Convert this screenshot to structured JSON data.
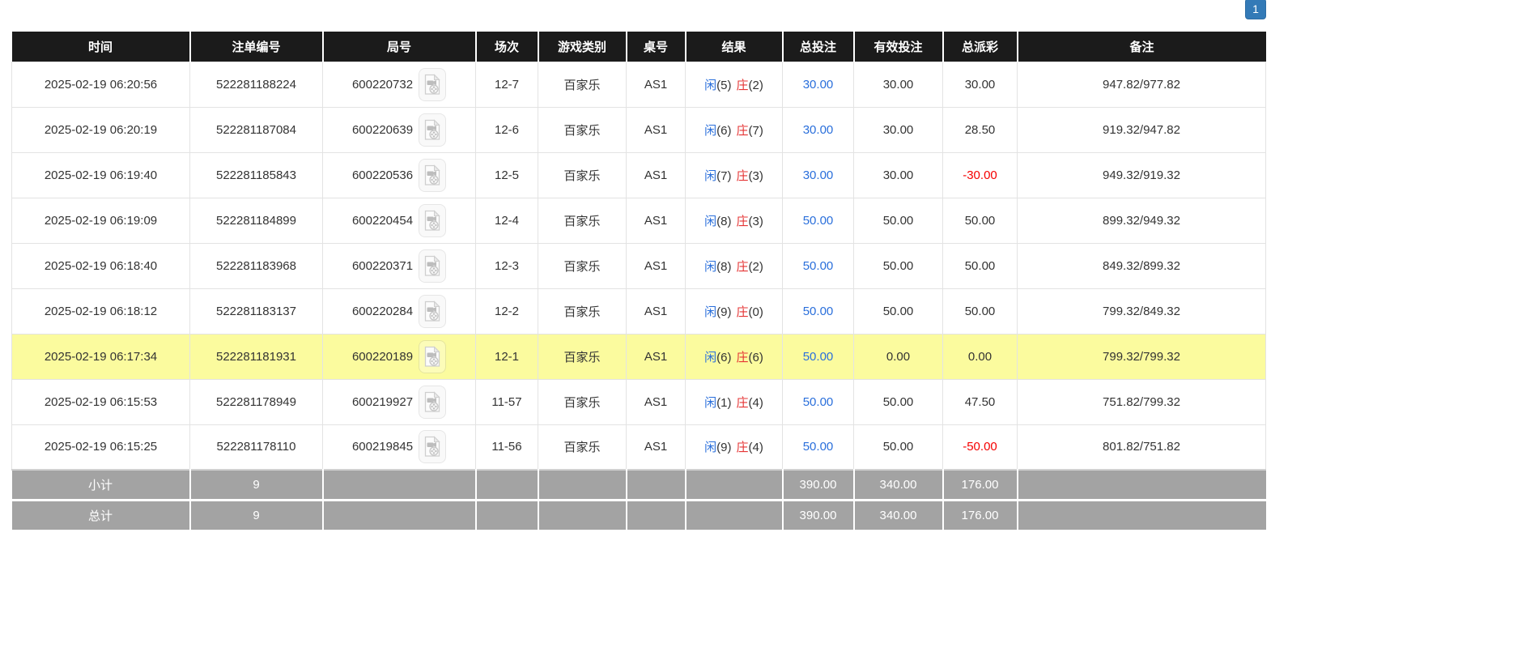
{
  "pagination": {
    "current_page": "1"
  },
  "colors": {
    "header_bg": "#1b1b1b",
    "footer_bg": "#a3a3a3",
    "highlight_yellow": "#fbfb9e",
    "player_blue": "#2a6fdb",
    "banker_red": "#e53535",
    "amount_blue": "#2a6fdb",
    "negative_red": "#f50000",
    "pagination_blue": "#337ab7"
  },
  "table": {
    "headers": [
      "时间",
      "注单编号",
      "局号",
      "场次",
      "游戏类别",
      "桌号",
      "结果",
      "总投注",
      "有效投注",
      "总派彩",
      "备注"
    ],
    "rows": [
      {
        "time": "2025-02-19 06:20:56",
        "bet_id": "522281188224",
        "round_id": "600220732",
        "session": "12-7",
        "game_type": "百家乐",
        "table_no": "AS1",
        "result": {
          "player": "闲",
          "player_pts": "(5)",
          "banker": "庄",
          "banker_pts": "(2)"
        },
        "total_bet": "30.00",
        "valid_bet": "30.00",
        "payout": "30.00",
        "remark": "947.82/977.82",
        "highlighted": false
      },
      {
        "time": "2025-02-19 06:20:19",
        "bet_id": "522281187084",
        "round_id": "600220639",
        "session": "12-6",
        "game_type": "百家乐",
        "table_no": "AS1",
        "result": {
          "player": "闲",
          "player_pts": "(6)",
          "banker": "庄",
          "banker_pts": "(7)"
        },
        "total_bet": "30.00",
        "valid_bet": "30.00",
        "payout": "28.50",
        "remark": "919.32/947.82",
        "highlighted": false
      },
      {
        "time": "2025-02-19 06:19:40",
        "bet_id": "522281185843",
        "round_id": "600220536",
        "session": "12-5",
        "game_type": "百家乐",
        "table_no": "AS1",
        "result": {
          "player": "闲",
          "player_pts": "(7)",
          "banker": "庄",
          "banker_pts": "(3)"
        },
        "total_bet": "30.00",
        "valid_bet": "30.00",
        "payout": "-30.00",
        "remark": "949.32/919.32",
        "highlighted": false
      },
      {
        "time": "2025-02-19 06:19:09",
        "bet_id": "522281184899",
        "round_id": "600220454",
        "session": "12-4",
        "game_type": "百家乐",
        "table_no": "AS1",
        "result": {
          "player": "闲",
          "player_pts": "(8)",
          "banker": "庄",
          "banker_pts": "(3)"
        },
        "total_bet": "50.00",
        "valid_bet": "50.00",
        "payout": "50.00",
        "remark": "899.32/949.32",
        "highlighted": false
      },
      {
        "time": "2025-02-19 06:18:40",
        "bet_id": "522281183968",
        "round_id": "600220371",
        "session": "12-3",
        "game_type": "百家乐",
        "table_no": "AS1",
        "result": {
          "player": "闲",
          "player_pts": "(8)",
          "banker": "庄",
          "banker_pts": "(2)"
        },
        "total_bet": "50.00",
        "valid_bet": "50.00",
        "payout": "50.00",
        "remark": "849.32/899.32",
        "highlighted": false
      },
      {
        "time": "2025-02-19 06:18:12",
        "bet_id": "522281183137",
        "round_id": "600220284",
        "session": "12-2",
        "game_type": "百家乐",
        "table_no": "AS1",
        "result": {
          "player": "闲",
          "player_pts": "(9)",
          "banker": "庄",
          "banker_pts": "(0)"
        },
        "total_bet": "50.00",
        "valid_bet": "50.00",
        "payout": "50.00",
        "remark": "799.32/849.32",
        "highlighted": false
      },
      {
        "time": "2025-02-19 06:17:34",
        "bet_id": "522281181931",
        "round_id": "600220189",
        "session": "12-1",
        "game_type": "百家乐",
        "table_no": "AS1",
        "result": {
          "player": "闲",
          "player_pts": "(6)",
          "banker": "庄",
          "banker_pts": "(6)"
        },
        "total_bet": "50.00",
        "valid_bet": "0.00",
        "payout": "0.00",
        "remark": "799.32/799.32",
        "highlighted": true
      },
      {
        "time": "2025-02-19 06:15:53",
        "bet_id": "522281178949",
        "round_id": "600219927",
        "session": "11-57",
        "game_type": "百家乐",
        "table_no": "AS1",
        "result": {
          "player": "闲",
          "player_pts": "(1)",
          "banker": "庄",
          "banker_pts": "(4)"
        },
        "total_bet": "50.00",
        "valid_bet": "50.00",
        "payout": "47.50",
        "remark": "751.82/799.32",
        "highlighted": false
      },
      {
        "time": "2025-02-19 06:15:25",
        "bet_id": "522281178110",
        "round_id": "600219845",
        "session": "11-56",
        "game_type": "百家乐",
        "table_no": "AS1",
        "result": {
          "player": "闲",
          "player_pts": "(9)",
          "banker": "庄",
          "banker_pts": "(4)"
        },
        "total_bet": "50.00",
        "valid_bet": "50.00",
        "payout": "-50.00",
        "remark": "801.82/751.82",
        "highlighted": false
      }
    ],
    "footer": [
      {
        "label": "小计",
        "count": "9",
        "total_bet": "390.00",
        "valid_bet": "340.00",
        "payout": "176.00"
      },
      {
        "label": "总计",
        "count": "9",
        "total_bet": "390.00",
        "valid_bet": "340.00",
        "payout": "176.00"
      }
    ]
  }
}
